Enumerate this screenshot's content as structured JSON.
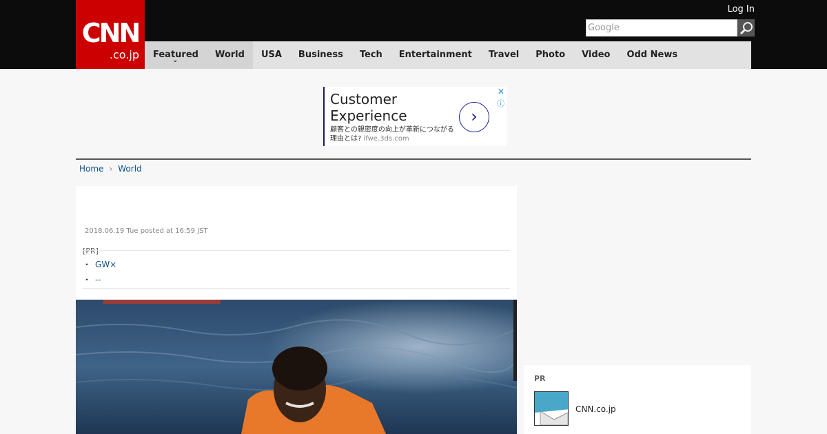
{
  "header": {
    "logo_line1": "CNN",
    "logo_line2": ".co.jp",
    "login": "Log In",
    "search_placeholder": "Google"
  },
  "nav": {
    "items": [
      {
        "label": "Featured"
      },
      {
        "label": "World"
      },
      {
        "label": "USA"
      },
      {
        "label": "Business"
      },
      {
        "label": "Tech"
      },
      {
        "label": "Entertainment"
      },
      {
        "label": "Travel"
      },
      {
        "label": "Photo"
      },
      {
        "label": "Video"
      },
      {
        "label": "Odd News"
      }
    ]
  },
  "ad": {
    "title": "Customer Experience",
    "desc": "顧客との親密度の向上が革新につながる理由とは?",
    "url": "ifwe.3ds.com"
  },
  "breadcrumb": {
    "home": "Home",
    "section": "World"
  },
  "article": {
    "date": "2018.06.19 Tue posted at 16:59 JST",
    "pr_label": "[PR]",
    "pr_links": [
      "GW×",
      "--"
    ]
  },
  "sidebar": {
    "pr_label": "PR",
    "item_text": "CNN.co.jp"
  },
  "colors": {
    "brand_red": "#cc0000",
    "topbar": "#0c0c0c",
    "nav_bg": "#e2e2e2",
    "link": "#0b4f8a"
  }
}
